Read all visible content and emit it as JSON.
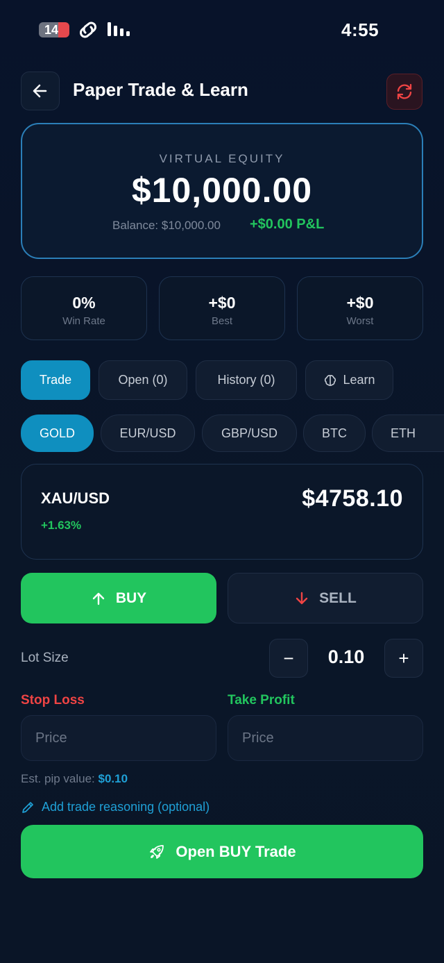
{
  "status_bar": {
    "time": "4:55",
    "badge_count": "14"
  },
  "header": {
    "title": "Paper Trade & Learn"
  },
  "equity": {
    "label": "VIRTUAL EQUITY",
    "value": "$10,000.00",
    "balance": "Balance: $10,000.00",
    "pnl": "+$0.00 P&L"
  },
  "stats": [
    {
      "value": "0%",
      "label": "Win Rate"
    },
    {
      "value": "+$0",
      "label": "Best"
    },
    {
      "value": "+$0",
      "label": "Worst"
    }
  ],
  "tabs": [
    {
      "label": "Trade"
    },
    {
      "label": "Open (0)"
    },
    {
      "label": "History (0)"
    },
    {
      "label": "Learn"
    }
  ],
  "instruments": [
    {
      "label": "GOLD"
    },
    {
      "label": "EUR/USD"
    },
    {
      "label": "GBP/USD"
    },
    {
      "label": "BTC"
    },
    {
      "label": "ETH"
    }
  ],
  "quote": {
    "symbol": "XAU/USD",
    "change": "+1.63%",
    "price": "$4758.10"
  },
  "side": {
    "buy": "BUY",
    "sell": "SELL"
  },
  "lot": {
    "label": "Lot Size",
    "value": "0.10",
    "minus": "−",
    "plus": "+"
  },
  "stop_loss": {
    "label": "Stop Loss",
    "placeholder": "Price"
  },
  "take_profit": {
    "label": "Take Profit",
    "placeholder": "Price"
  },
  "pip": {
    "label": "Est. pip value:",
    "value": "$0.10"
  },
  "reasoning": {
    "label": "Add trade reasoning (optional)"
  },
  "submit": {
    "label": "Open BUY Trade"
  },
  "colors": {
    "accent": "#0f8fbf",
    "buy": "#22c55e",
    "sell": "#ef4444",
    "background": "#0a1628"
  }
}
